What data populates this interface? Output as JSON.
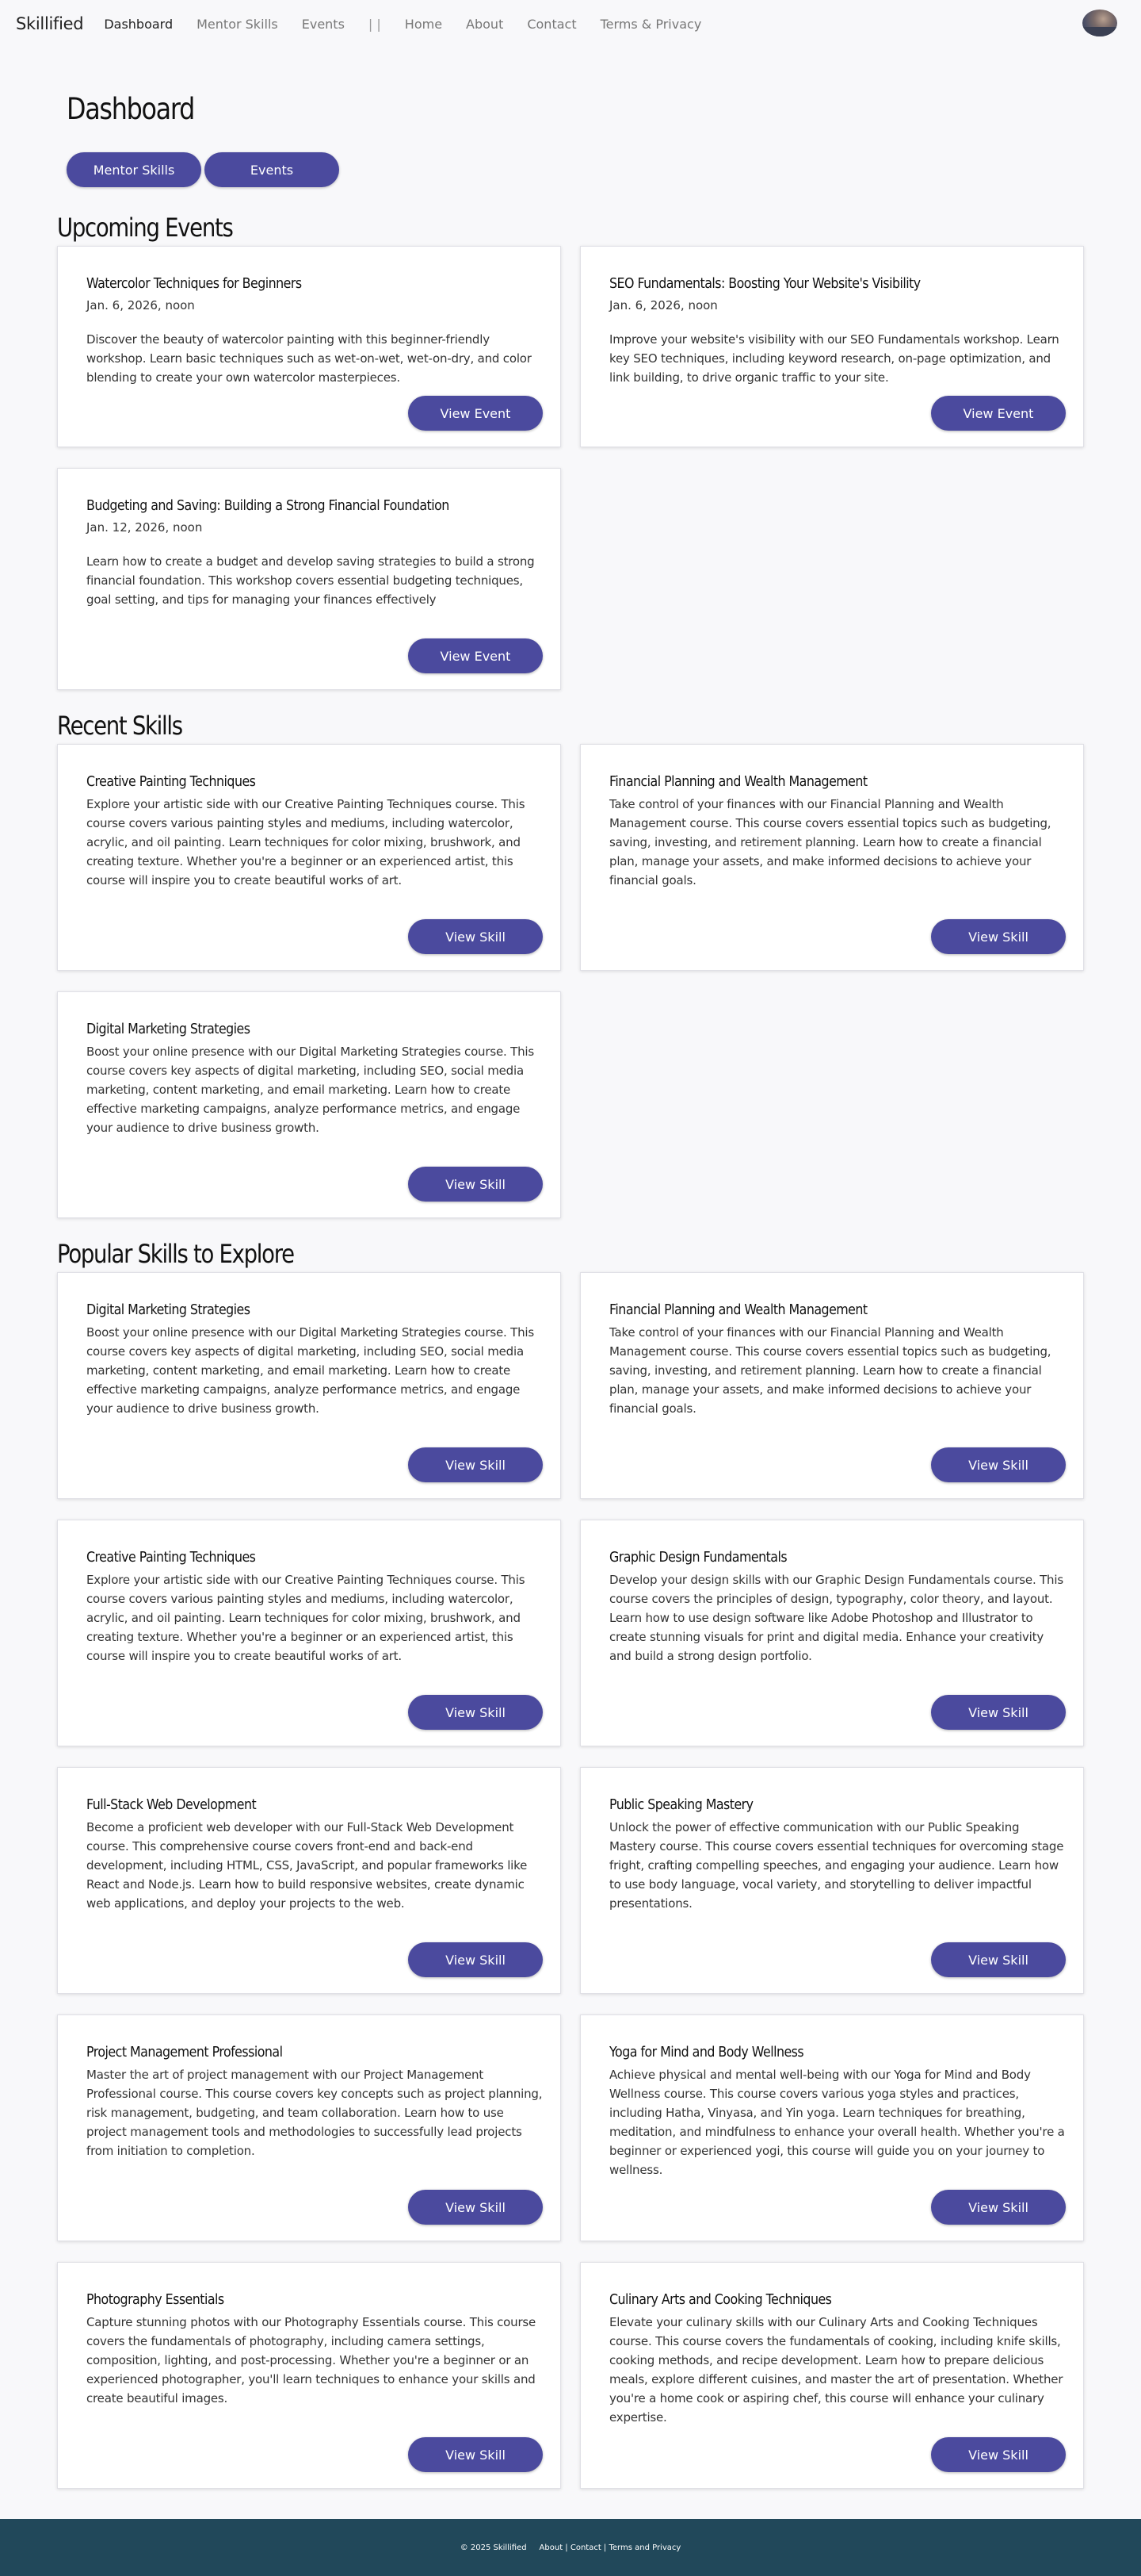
{
  "brand": "Skillified",
  "nav": {
    "links": [
      "Dashboard",
      "Mentor Skills",
      "Events"
    ],
    "separator": "| |",
    "site_links": [
      "Home",
      "About",
      "Contact",
      "Terms & Privacy"
    ]
  },
  "page": {
    "title": "Dashboard",
    "toggles": [
      "Mentor Skills",
      "Events"
    ]
  },
  "upcoming_events": {
    "title": "Upcoming Events",
    "button_label": "View Event",
    "items": [
      {
        "title": "Watercolor Techniques for Beginners",
        "date": "Jan. 6, 2026, noon",
        "desc": "Discover the beauty of watercolor painting with this beginner-friendly workshop. Learn basic techniques such as wet-on-wet, wet-on-dry, and color blending to create your own watercolor masterpieces."
      },
      {
        "title": "SEO Fundamentals: Boosting Your Website's Visibility",
        "date": "Jan. 6, 2026, noon",
        "desc": "Improve your website's visibility with our SEO Fundamentals workshop. Learn key SEO techniques, including keyword research, on-page optimization, and link building, to drive organic traffic to your site."
      },
      {
        "title": "Budgeting and Saving: Building a Strong Financial Foundation",
        "date": "Jan. 12, 2026, noon",
        "desc": "Learn how to create a budget and develop saving strategies to build a strong financial foundation. This workshop covers essential budgeting techniques, goal setting, and tips for managing your finances effectively"
      }
    ]
  },
  "recent_skills": {
    "title": "Recent Skills",
    "button_label": "View Skill",
    "items": [
      {
        "title": "Creative Painting Techniques",
        "desc": "Explore your artistic side with our Creative Painting Techniques course. This course covers various painting styles and mediums, including watercolor, acrylic, and oil painting. Learn techniques for color mixing, brushwork, and creating texture. Whether you're a beginner or an experienced artist, this course will inspire you to create beautiful works of art."
      },
      {
        "title": "Financial Planning and Wealth Management",
        "desc": "Take control of your finances with our Financial Planning and Wealth Management course. This course covers essential topics such as budgeting, saving, investing, and retirement planning. Learn how to create a financial plan, manage your assets, and make informed decisions to achieve your financial goals."
      },
      {
        "title": "Digital Marketing Strategies",
        "desc": "Boost your online presence with our Digital Marketing Strategies course. This course covers key aspects of digital marketing, including SEO, social media marketing, content marketing, and email marketing. Learn how to create effective marketing campaigns, analyze performance metrics, and engage your audience to drive business growth."
      }
    ]
  },
  "popular_skills": {
    "title": "Popular Skills to Explore",
    "button_label": "View Skill",
    "items": [
      {
        "title": "Digital Marketing Strategies",
        "desc": "Boost your online presence with our Digital Marketing Strategies course. This course covers key aspects of digital marketing, including SEO, social media marketing, content marketing, and email marketing. Learn how to create effective marketing campaigns, analyze performance metrics, and engage your audience to drive business growth."
      },
      {
        "title": "Financial Planning and Wealth Management",
        "desc": "Take control of your finances with our Financial Planning and Wealth Management course. This course covers essential topics such as budgeting, saving, investing, and retirement planning. Learn how to create a financial plan, manage your assets, and make informed decisions to achieve your financial goals."
      },
      {
        "title": "Creative Painting Techniques",
        "desc": "Explore your artistic side with our Creative Painting Techniques course. This course covers various painting styles and mediums, including watercolor, acrylic, and oil painting. Learn techniques for color mixing, brushwork, and creating texture. Whether you're a beginner or an experienced artist, this course will inspire you to create beautiful works of art."
      },
      {
        "title": "Graphic Design Fundamentals",
        "desc": "Develop your design skills with our Graphic Design Fundamentals course. This course covers the principles of design, typography, color theory, and layout. Learn how to use design software like Adobe Photoshop and Illustrator to create stunning visuals for print and digital media. Enhance your creativity and build a strong design portfolio."
      },
      {
        "title": "Full-Stack Web Development",
        "desc": "Become a proficient web developer with our Full-Stack Web Development course. This comprehensive course covers front-end and back-end development, including HTML, CSS, JavaScript, and popular frameworks like React and Node.js. Learn how to build responsive websites, create dynamic web applications, and deploy your projects to the web."
      },
      {
        "title": "Public Speaking Mastery",
        "desc": "Unlock the power of effective communication with our Public Speaking Mastery course. This course covers essential techniques for overcoming stage fright, crafting compelling speeches, and engaging your audience. Learn how to use body language, vocal variety, and storytelling to deliver impactful presentations."
      },
      {
        "title": "Project Management Professional",
        "desc": "Master the art of project management with our Project Management Professional course. This course covers key concepts such as project planning, risk management, budgeting, and team collaboration. Learn how to use project management tools and methodologies to successfully lead projects from initiation to completion."
      },
      {
        "title": "Yoga for Mind and Body Wellness",
        "desc": "Achieve physical and mental well-being with our Yoga for Mind and Body Wellness course. This course covers various yoga styles and practices, including Hatha, Vinyasa, and Yin yoga. Learn techniques for breathing, meditation, and mindfulness to enhance your overall health. Whether you're a beginner or experienced yogi, this course will guide you on your journey to wellness."
      },
      {
        "title": "Photography Essentials",
        "desc": "Capture stunning photos with our Photography Essentials course. This course covers the fundamentals of photography, including camera settings, composition, lighting, and post-processing. Whether you're a beginner or an experienced photographer, you'll learn techniques to enhance your skills and create beautiful images."
      },
      {
        "title": "Culinary Arts and Cooking Techniques",
        "desc": "Elevate your culinary skills with our Culinary Arts and Cooking Techniques course. This course covers the fundamentals of cooking, including knife skills, cooking methods, and recipe development. Learn how to prepare delicious meals, explore different cuisines, and master the art of presentation. Whether you're a home cook or aspiring chef, this course will enhance your culinary expertise."
      }
    ]
  },
  "footer": {
    "copyright": "© 2025 Skillified",
    "links": "About | Contact | Terms and Privacy"
  },
  "colors": {
    "accent": "#4b4a9e",
    "footer": "#21485a",
    "background": "#f8f8fa"
  }
}
